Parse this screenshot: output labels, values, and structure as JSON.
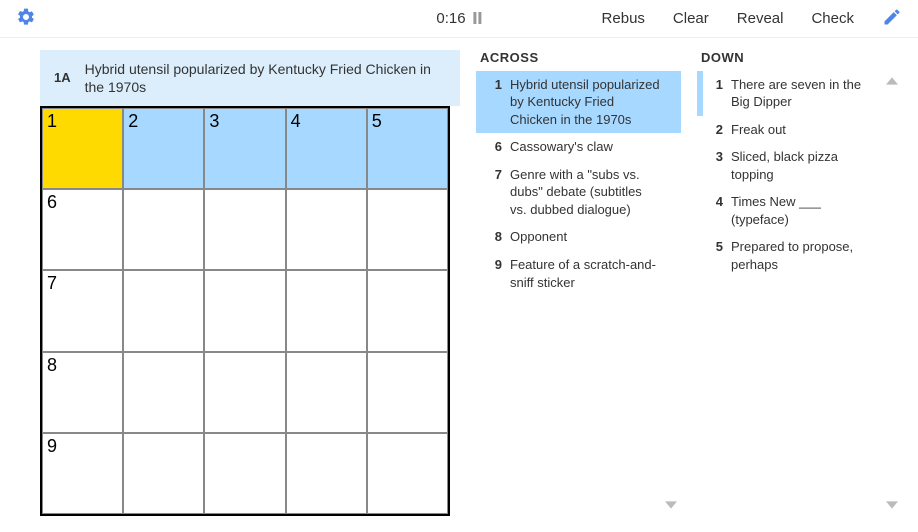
{
  "toolbar": {
    "timer": "0:16",
    "actions": {
      "rebus": "Rebus",
      "clear": "Clear",
      "reveal": "Reveal",
      "check": "Check"
    }
  },
  "clueBar": {
    "num": "1A",
    "text": "Hybrid utensil popularized by Kentucky Fried Chicken in the 1970s"
  },
  "grid": {
    "size": 5,
    "numbers": {
      "0": "1",
      "1": "2",
      "2": "3",
      "3": "4",
      "4": "5",
      "5": "6",
      "10": "7",
      "15": "8",
      "20": "9"
    },
    "highlightRow": 0,
    "cursor": 0
  },
  "across": {
    "title": "ACROSS",
    "clues": [
      {
        "n": "1",
        "t": "Hybrid utensil popularized by Kentucky Fried Chicken in the 1970s",
        "active": true
      },
      {
        "n": "6",
        "t": "Cassowary's claw"
      },
      {
        "n": "7",
        "t": "Genre with a \"subs vs. dubs\" debate (subtitles vs. dubbed dialogue)"
      },
      {
        "n": "8",
        "t": "Opponent"
      },
      {
        "n": "9",
        "t": "Feature of a scratch-and-sniff sticker"
      }
    ]
  },
  "down": {
    "title": "DOWN",
    "clues": [
      {
        "n": "1",
        "t": "There are seven in the Big Dipper",
        "related": true
      },
      {
        "n": "2",
        "t": "Freak out"
      },
      {
        "n": "3",
        "t": "Sliced, black pizza topping"
      },
      {
        "n": "4",
        "t": "Times New ___ (typeface)"
      },
      {
        "n": "5",
        "t": "Prepared to propose, perhaps"
      }
    ]
  }
}
